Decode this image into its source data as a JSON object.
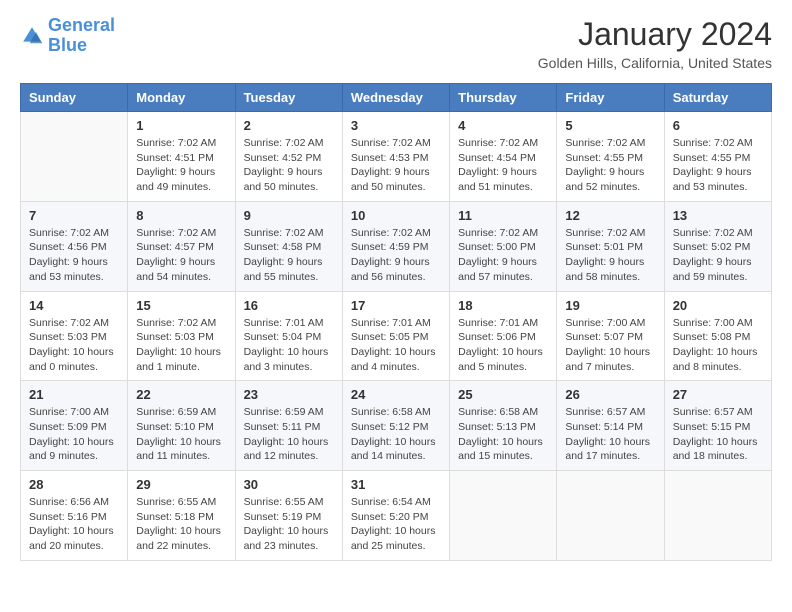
{
  "logo": {
    "line1": "General",
    "line2": "Blue"
  },
  "title": "January 2024",
  "location": "Golden Hills, California, United States",
  "headers": [
    "Sunday",
    "Monday",
    "Tuesday",
    "Wednesday",
    "Thursday",
    "Friday",
    "Saturday"
  ],
  "weeks": [
    [
      {
        "day": "",
        "sunrise": "",
        "sunset": "",
        "daylight": ""
      },
      {
        "day": "1",
        "sunrise": "Sunrise: 7:02 AM",
        "sunset": "Sunset: 4:51 PM",
        "daylight": "Daylight: 9 hours and 49 minutes."
      },
      {
        "day": "2",
        "sunrise": "Sunrise: 7:02 AM",
        "sunset": "Sunset: 4:52 PM",
        "daylight": "Daylight: 9 hours and 50 minutes."
      },
      {
        "day": "3",
        "sunrise": "Sunrise: 7:02 AM",
        "sunset": "Sunset: 4:53 PM",
        "daylight": "Daylight: 9 hours and 50 minutes."
      },
      {
        "day": "4",
        "sunrise": "Sunrise: 7:02 AM",
        "sunset": "Sunset: 4:54 PM",
        "daylight": "Daylight: 9 hours and 51 minutes."
      },
      {
        "day": "5",
        "sunrise": "Sunrise: 7:02 AM",
        "sunset": "Sunset: 4:55 PM",
        "daylight": "Daylight: 9 hours and 52 minutes."
      },
      {
        "day": "6",
        "sunrise": "Sunrise: 7:02 AM",
        "sunset": "Sunset: 4:55 PM",
        "daylight": "Daylight: 9 hours and 53 minutes."
      }
    ],
    [
      {
        "day": "7",
        "sunrise": "Sunrise: 7:02 AM",
        "sunset": "Sunset: 4:56 PM",
        "daylight": "Daylight: 9 hours and 53 minutes."
      },
      {
        "day": "8",
        "sunrise": "Sunrise: 7:02 AM",
        "sunset": "Sunset: 4:57 PM",
        "daylight": "Daylight: 9 hours and 54 minutes."
      },
      {
        "day": "9",
        "sunrise": "Sunrise: 7:02 AM",
        "sunset": "Sunset: 4:58 PM",
        "daylight": "Daylight: 9 hours and 55 minutes."
      },
      {
        "day": "10",
        "sunrise": "Sunrise: 7:02 AM",
        "sunset": "Sunset: 4:59 PM",
        "daylight": "Daylight: 9 hours and 56 minutes."
      },
      {
        "day": "11",
        "sunrise": "Sunrise: 7:02 AM",
        "sunset": "Sunset: 5:00 PM",
        "daylight": "Daylight: 9 hours and 57 minutes."
      },
      {
        "day": "12",
        "sunrise": "Sunrise: 7:02 AM",
        "sunset": "Sunset: 5:01 PM",
        "daylight": "Daylight: 9 hours and 58 minutes."
      },
      {
        "day": "13",
        "sunrise": "Sunrise: 7:02 AM",
        "sunset": "Sunset: 5:02 PM",
        "daylight": "Daylight: 9 hours and 59 minutes."
      }
    ],
    [
      {
        "day": "14",
        "sunrise": "Sunrise: 7:02 AM",
        "sunset": "Sunset: 5:03 PM",
        "daylight": "Daylight: 10 hours and 0 minutes."
      },
      {
        "day": "15",
        "sunrise": "Sunrise: 7:02 AM",
        "sunset": "Sunset: 5:03 PM",
        "daylight": "Daylight: 10 hours and 1 minute."
      },
      {
        "day": "16",
        "sunrise": "Sunrise: 7:01 AM",
        "sunset": "Sunset: 5:04 PM",
        "daylight": "Daylight: 10 hours and 3 minutes."
      },
      {
        "day": "17",
        "sunrise": "Sunrise: 7:01 AM",
        "sunset": "Sunset: 5:05 PM",
        "daylight": "Daylight: 10 hours and 4 minutes."
      },
      {
        "day": "18",
        "sunrise": "Sunrise: 7:01 AM",
        "sunset": "Sunset: 5:06 PM",
        "daylight": "Daylight: 10 hours and 5 minutes."
      },
      {
        "day": "19",
        "sunrise": "Sunrise: 7:00 AM",
        "sunset": "Sunset: 5:07 PM",
        "daylight": "Daylight: 10 hours and 7 minutes."
      },
      {
        "day": "20",
        "sunrise": "Sunrise: 7:00 AM",
        "sunset": "Sunset: 5:08 PM",
        "daylight": "Daylight: 10 hours and 8 minutes."
      }
    ],
    [
      {
        "day": "21",
        "sunrise": "Sunrise: 7:00 AM",
        "sunset": "Sunset: 5:09 PM",
        "daylight": "Daylight: 10 hours and 9 minutes."
      },
      {
        "day": "22",
        "sunrise": "Sunrise: 6:59 AM",
        "sunset": "Sunset: 5:10 PM",
        "daylight": "Daylight: 10 hours and 11 minutes."
      },
      {
        "day": "23",
        "sunrise": "Sunrise: 6:59 AM",
        "sunset": "Sunset: 5:11 PM",
        "daylight": "Daylight: 10 hours and 12 minutes."
      },
      {
        "day": "24",
        "sunrise": "Sunrise: 6:58 AM",
        "sunset": "Sunset: 5:12 PM",
        "daylight": "Daylight: 10 hours and 14 minutes."
      },
      {
        "day": "25",
        "sunrise": "Sunrise: 6:58 AM",
        "sunset": "Sunset: 5:13 PM",
        "daylight": "Daylight: 10 hours and 15 minutes."
      },
      {
        "day": "26",
        "sunrise": "Sunrise: 6:57 AM",
        "sunset": "Sunset: 5:14 PM",
        "daylight": "Daylight: 10 hours and 17 minutes."
      },
      {
        "day": "27",
        "sunrise": "Sunrise: 6:57 AM",
        "sunset": "Sunset: 5:15 PM",
        "daylight": "Daylight: 10 hours and 18 minutes."
      }
    ],
    [
      {
        "day": "28",
        "sunrise": "Sunrise: 6:56 AM",
        "sunset": "Sunset: 5:16 PM",
        "daylight": "Daylight: 10 hours and 20 minutes."
      },
      {
        "day": "29",
        "sunrise": "Sunrise: 6:55 AM",
        "sunset": "Sunset: 5:18 PM",
        "daylight": "Daylight: 10 hours and 22 minutes."
      },
      {
        "day": "30",
        "sunrise": "Sunrise: 6:55 AM",
        "sunset": "Sunset: 5:19 PM",
        "daylight": "Daylight: 10 hours and 23 minutes."
      },
      {
        "day": "31",
        "sunrise": "Sunrise: 6:54 AM",
        "sunset": "Sunset: 5:20 PM",
        "daylight": "Daylight: 10 hours and 25 minutes."
      },
      {
        "day": "",
        "sunrise": "",
        "sunset": "",
        "daylight": ""
      },
      {
        "day": "",
        "sunrise": "",
        "sunset": "",
        "daylight": ""
      },
      {
        "day": "",
        "sunrise": "",
        "sunset": "",
        "daylight": ""
      }
    ]
  ]
}
